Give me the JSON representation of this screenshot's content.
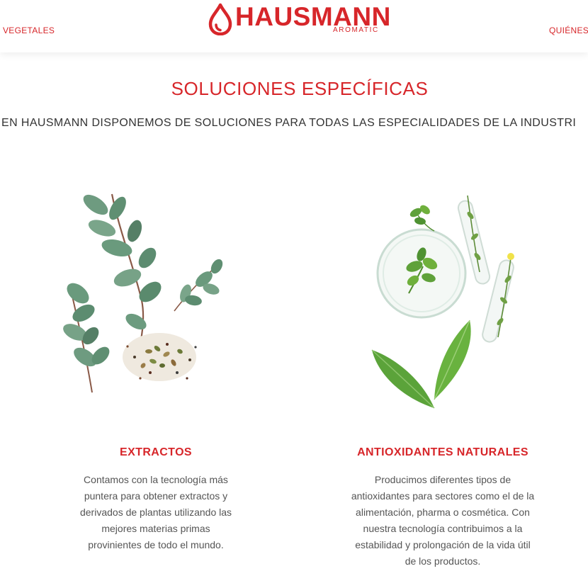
{
  "header": {
    "nav_left": "VEGETALES",
    "nav_right": "QUIÉNES",
    "brand_name": "HAUSMANN",
    "brand_sub": "AROMATIC"
  },
  "section": {
    "title": "SOLUCIONES ESPECÍFICAS",
    "subtitle": "EN HAUSMANN DISPONEMOS DE SOLUCIONES PARA TODAS LAS ESPECIALIDADES DE LA INDUSTRI"
  },
  "cards": [
    {
      "title": "EXTRACTOS",
      "image": "eucalyptus-and-seeds-image",
      "lines": [
        "Contamos con la tecnología más",
        "puntera para obtener extractos y",
        "derivados de plantas utilizando las",
        "mejores materias primas",
        "provinientes de todo el mundo."
      ]
    },
    {
      "title": "ANTIOXIDANTES NATURALES",
      "image": "petri-dish-and-herbs-image",
      "lines": [
        "Producimos diferentes tipos de",
        "antioxidantes para sectores como el de la",
        "alimentación, pharma o cosmética. Con",
        "nuestra tecnología contribuimos a la",
        "estabilidad y prolongación de la vida útil",
        "de los productos."
      ]
    }
  ],
  "colors": {
    "brand_red": "#d7262a",
    "body_text": "#555555",
    "heading_text": "#333333",
    "leaf_green": "#5a8f6a",
    "herb_green": "#6fb03c"
  }
}
